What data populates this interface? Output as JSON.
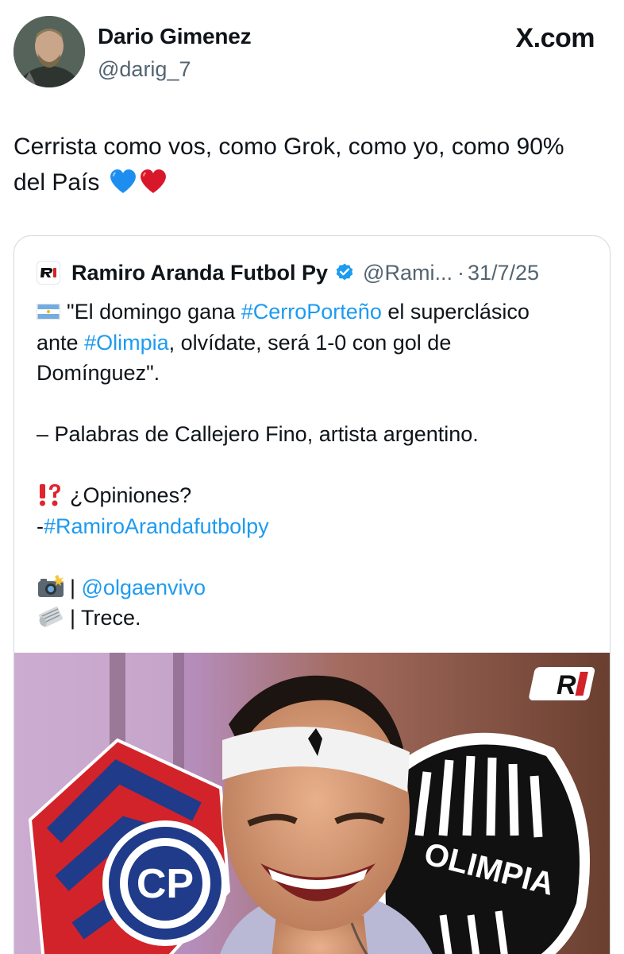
{
  "source": "X.com",
  "author": {
    "name": "Dario Gimenez",
    "handle": "@darig_7"
  },
  "tweet": {
    "text": "Cerrista como vos, como Grok, como yo, como 90% del País",
    "emojis": [
      "blue-heart",
      "red-heart"
    ]
  },
  "quoted": {
    "name": "Ramiro Aranda Futbol Py",
    "verified": true,
    "handle": "@Rami...",
    "separator": "·",
    "date": "31/7/25",
    "body": {
      "l1_pre": "\"El domingo gana ",
      "l1_tag": "#CerroPorteño",
      "l1_post": " el superclásico",
      "l2_pre": "ante ",
      "l2_tag": "#Olimpia",
      "l2_post": ", olvídate, será 1-0 con gol de",
      "l3": "Domínguez\".",
      "l4": "– Palabras de Callejero Fino, artista argentino.",
      "l5": "¿Opiniones?",
      "l6_pre": "-",
      "l6_tag": "#RamiroArandafutbolpy",
      "l7_pre": "| ",
      "l7_mention": "@olgaenvivo",
      "l8": "| Trece."
    },
    "media": {
      "badge": "R",
      "olimpia_text": "OLIMPIA",
      "cerro_text": "CP"
    }
  },
  "colors": {
    "text": "#0f1419",
    "muted": "#536471",
    "link": "#1d9bf0",
    "border": "#cfd9de",
    "verified": "#1d9bf0",
    "cerro_red": "#d2232a",
    "cerro_blue": "#1f3b8a"
  }
}
